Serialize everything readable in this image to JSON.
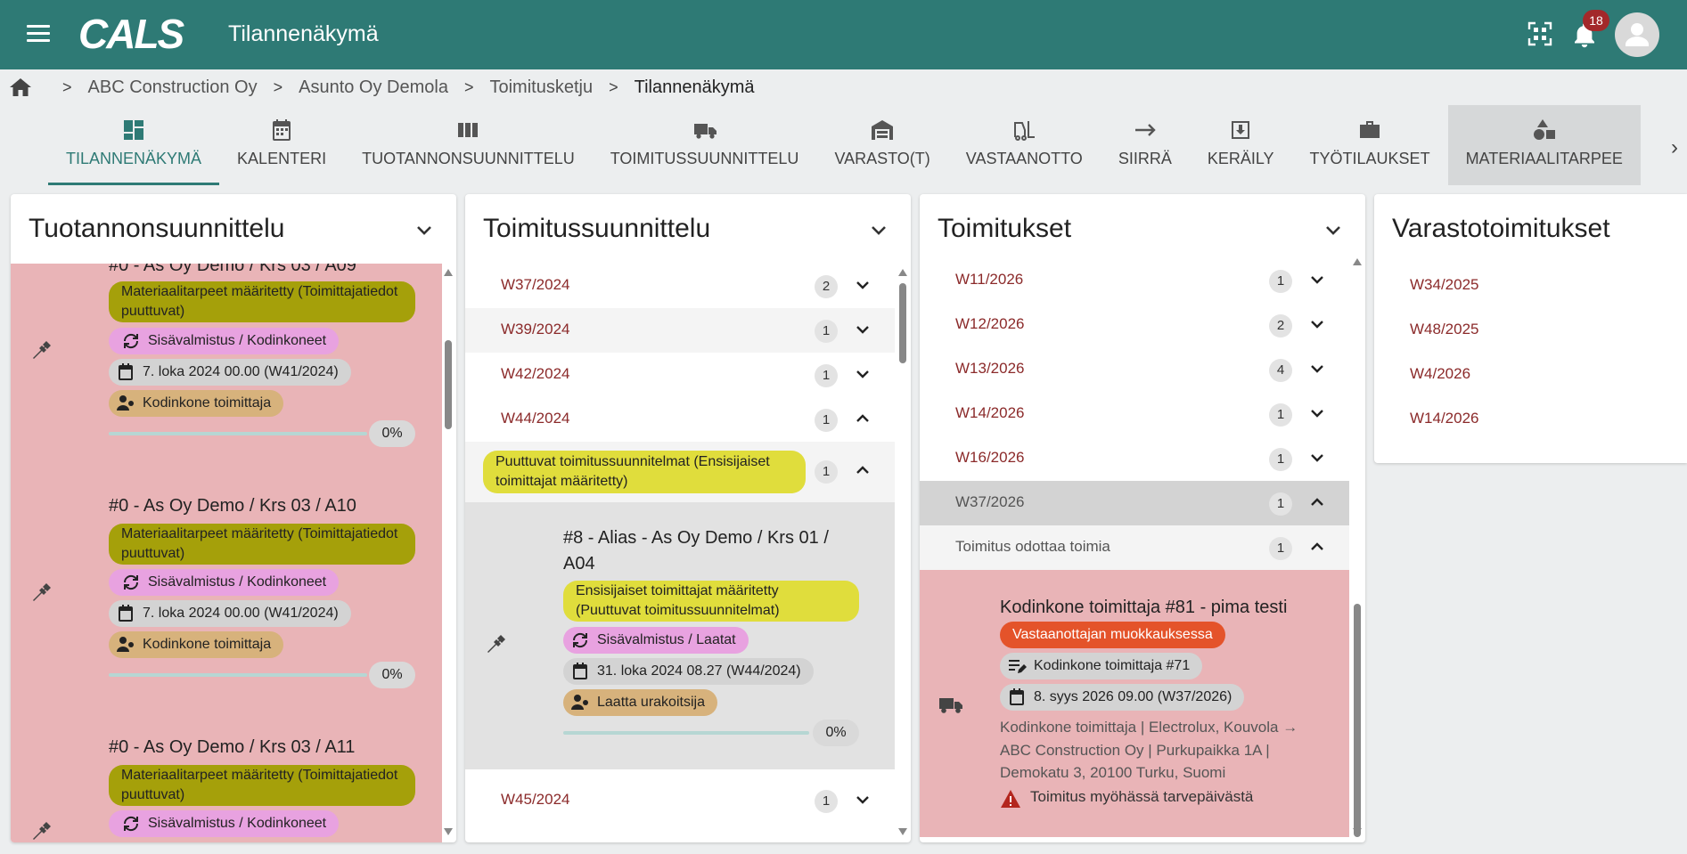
{
  "app": {
    "title": "Tilannenäkymä",
    "logo": "CALS",
    "notifications": "18"
  },
  "breadcrumb": [
    "ABC Construction Oy",
    "Asunto Oy Demola",
    "Toimitusketju",
    "Tilannenäkymä"
  ],
  "tabs": [
    "TILANNENÄKYMÄ",
    "KALENTERI",
    "TUOTANNONSUUNNITTELU",
    "TOIMITUSSUUNNITTELU",
    "VARASTO(T)",
    "VASTAANOTTO",
    "SIIRRÄ",
    "KERÄILY",
    "TYÖTILAUKSET",
    "MATERIAALITARPEE"
  ],
  "panels": {
    "production": {
      "title": "Tuotannonsuunnittelu",
      "cards": [
        {
          "title": "#0 - As Oy Demo / Krs 03 / A09",
          "status": "Materiaalitarpeet määritetty (Toimittajatiedot puuttuvat)",
          "category": "Sisävalmistus / Kodinkoneet",
          "date": "7. loka 2024 00.00 (W41/2024)",
          "supplier": "Kodinkone toimittaja",
          "progress": "0%"
        },
        {
          "title": "#0 - As Oy Demo / Krs 03 / A10",
          "status": "Materiaalitarpeet määritetty (Toimittajatiedot puuttuvat)",
          "category": "Sisävalmistus / Kodinkoneet",
          "date": "7. loka 2024 00.00 (W41/2024)",
          "supplier": "Kodinkone toimittaja",
          "progress": "0%"
        },
        {
          "title": "#0 - As Oy Demo / Krs 03 / A11",
          "status": "Materiaalitarpeet määritetty (Toimittajatiedot puuttuvat)",
          "category": "Sisävalmistus / Kodinkoneet"
        }
      ]
    },
    "delivery_planning": {
      "title": "Toimitussuunnittelu",
      "weeks": [
        {
          "label": "W37/2024",
          "count": "2"
        },
        {
          "label": "W39/2024",
          "count": "1"
        },
        {
          "label": "W42/2024",
          "count": "1"
        },
        {
          "label": "W44/2024",
          "count": "1"
        }
      ],
      "group": {
        "label": "Puuttuvat toimitussuunnitelmat (Ensisijaiset toimittajat määritetty)",
        "count": "1"
      },
      "card": {
        "title": "#8 - Alias - As Oy Demo / Krs 01 / A04",
        "status": "Ensisijaiset toimittajat määritetty (Puuttuvat toimitussuunnitelmat)",
        "category": "Sisävalmistus / Laatat",
        "date": "31. loka 2024 08.27 (W44/2024)",
        "supplier": "Laatta urakoitsija",
        "progress": "0%"
      },
      "week_after": {
        "label": "W45/2024",
        "count": "1"
      }
    },
    "deliveries": {
      "title": "Toimitukset",
      "weeks": [
        {
          "label": "W11/2026",
          "count": "1"
        },
        {
          "label": "W12/2026",
          "count": "2"
        },
        {
          "label": "W13/2026",
          "count": "4"
        },
        {
          "label": "W14/2026",
          "count": "1"
        },
        {
          "label": "W16/2026",
          "count": "1"
        },
        {
          "label": "W37/2026",
          "count": "1"
        }
      ],
      "group": {
        "label": "Toimitus odottaa toimia",
        "count": "1"
      },
      "card": {
        "title": "Kodinkone toimittaja #81 - pima testi",
        "status": "Vastaanottajan muokkauksessa",
        "order": "Kodinkone toimittaja #71",
        "date": "8. syys 2026 09.00 (W37/2026)",
        "route_line1": "Kodinkone toimittaja | Electrolux, Kouvola →",
        "route_line2": "ABC Construction Oy | Purkupaikka 1A |",
        "route_line3": "Demokatu 3, 20100 Turku, Suomi",
        "warning": "Toimitus myöhässä tarvepäivästä"
      }
    },
    "warehouse": {
      "title": "Varastotoimitukset",
      "weeks": [
        "W34/2025",
        "W48/2025",
        "W4/2026",
        "W14/2026"
      ]
    }
  },
  "colors": {
    "primary": "#2e7a75",
    "card_bg": "#e9b4b7",
    "week_text": "#8b2a2a",
    "olive": "#a5a00a",
    "yellow": "#e0dd3c",
    "pink": "#e8a2e0",
    "tan": "#d7b27c",
    "orange": "#e4532a"
  }
}
